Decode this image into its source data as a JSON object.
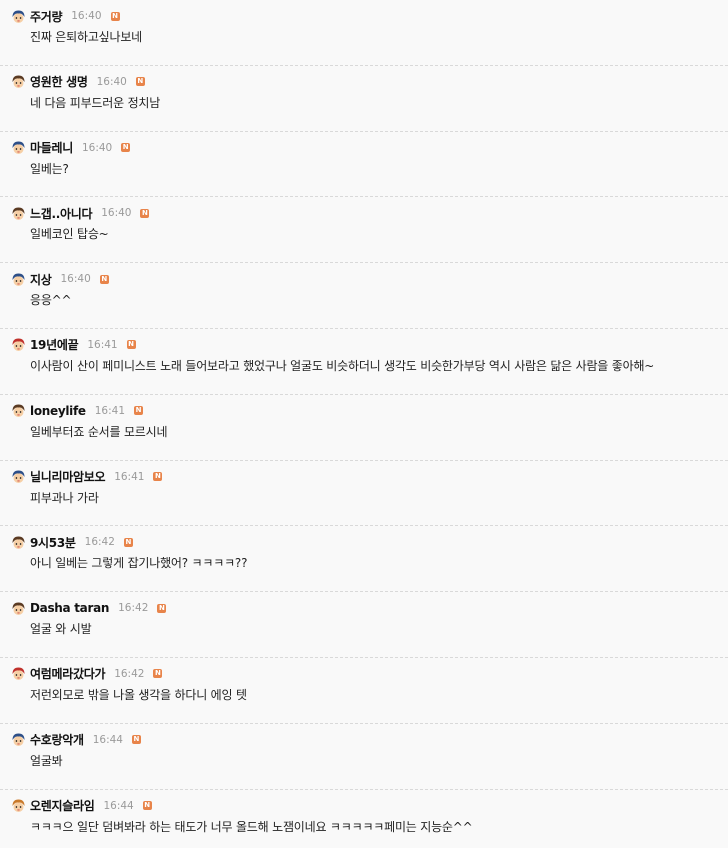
{
  "badge_text": "N",
  "icons": {
    "avatar_variants": {
      "blue": "blue-hair-face-avatar-icon",
      "red": "red-hat-face-avatar-icon",
      "brown": "brown-hair-face-avatar-icon",
      "orange": "orange-hair-face-avatar-icon"
    },
    "badge": "new-badge-icon"
  },
  "colors": {
    "background": "#f9f9f9",
    "nickname": "#111111",
    "time": "#9a9a9a",
    "badge": "#e8844a",
    "divider": "#d9d9d9",
    "avatar_blue_hair": "#2d4f88",
    "avatar_red_hat": "#c0312b",
    "avatar_brown_hair": "#5a3a22",
    "avatar_orange_hair": "#c9792a"
  },
  "comments": [
    {
      "nickname": "주거량",
      "time": "16:40",
      "text": "진짜 은퇴하고싶나보네",
      "avatar": "blue"
    },
    {
      "nickname": "영원한 생명",
      "time": "16:40",
      "text": "네 다음 피부드러운 정치남",
      "avatar": "brown"
    },
    {
      "nickname": "마들레니",
      "time": "16:40",
      "text": "일베는?",
      "avatar": "blue"
    },
    {
      "nickname": "느갭..아니다",
      "time": "16:40",
      "text": "일베코인 탑승~",
      "avatar": "brown"
    },
    {
      "nickname": "지상",
      "time": "16:40",
      "text": "응응^^",
      "avatar": "blue"
    },
    {
      "nickname": "19년에끝",
      "time": "16:41",
      "text": "이사람이 산이 페미니스트 노래 들어보라고 했었구나 얼굴도 비슷하더니 생각도 비슷한가부당 역시 사람은 닮은 사람을 좋아해~",
      "avatar": "red"
    },
    {
      "nickname": "loneylife",
      "time": "16:41",
      "text": "일베부터죠 순서를 모르시네",
      "avatar": "brown"
    },
    {
      "nickname": "닐니리마암보오",
      "time": "16:41",
      "text": "피부과나 가라",
      "avatar": "blue"
    },
    {
      "nickname": "9시53분",
      "time": "16:42",
      "text": "아니 일베는 그렇게 잡기나했어? ㅋㅋㅋㅋ??",
      "avatar": "brown"
    },
    {
      "nickname": "Dasha taran",
      "time": "16:42",
      "text": "얼굴 와 시발",
      "avatar": "brown"
    },
    {
      "nickname": "여럼메라갔다가",
      "time": "16:42",
      "text": "저런외모로 밖을 나올 생각을 하다니 에잉 텟",
      "avatar": "red"
    },
    {
      "nickname": "수호랑악개",
      "time": "16:44",
      "text": "얼굴봐",
      "avatar": "blue"
    },
    {
      "nickname": "오렌지슬라임",
      "time": "16:44",
      "text": "ㅋㅋㅋ으 일단 덤벼봐라 하는 태도가 너무 올드해 노잼이네요 ㅋㅋㅋㅋㅋ페미는 지능순^^",
      "avatar": "orange"
    }
  ]
}
